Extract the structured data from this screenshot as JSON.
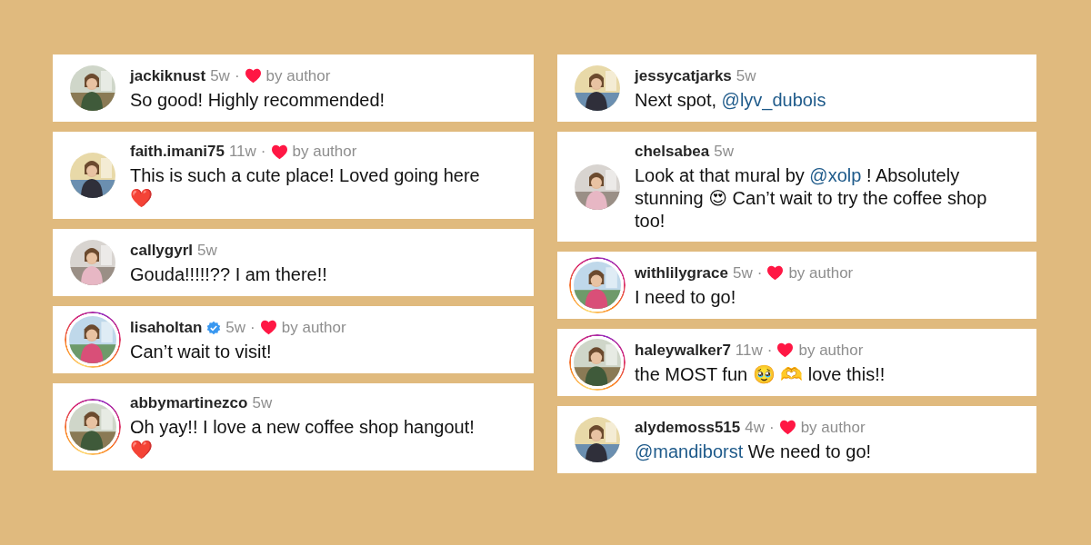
{
  "columns": [
    {
      "comments": [
        {
          "username": "jackiknust",
          "verified": false,
          "time": "5w",
          "separator": "·",
          "liked_by_author": true,
          "liked_label": "by author",
          "story_ring": false,
          "text": [
            {
              "kind": "text",
              "text": "So good! Highly recommended!"
            }
          ]
        },
        {
          "username": "faith.imani75",
          "verified": false,
          "time": "11w",
          "separator": "·",
          "liked_by_author": true,
          "liked_label": "by author",
          "story_ring": false,
          "text": [
            {
              "kind": "text",
              "text": "This is such a cute place! Loved going here ❤️"
            }
          ]
        },
        {
          "username": "callygyrl",
          "verified": false,
          "time": "5w",
          "liked_by_author": false,
          "story_ring": false,
          "text": [
            {
              "kind": "text",
              "text": "Gouda!!!!!?? I am there!!"
            }
          ]
        },
        {
          "username": "lisaholtan",
          "verified": true,
          "time": "5w",
          "separator": "·",
          "liked_by_author": true,
          "liked_label": "by author",
          "story_ring": true,
          "text": [
            {
              "kind": "text",
              "text": "Can’t wait to visit!"
            }
          ]
        },
        {
          "username": "abbymartinezco",
          "verified": false,
          "time": "5w",
          "liked_by_author": false,
          "story_ring": true,
          "text": [
            {
              "kind": "text",
              "text": "Oh yay!! I love a new coffee shop hangout! ❤️"
            }
          ]
        }
      ]
    },
    {
      "comments": [
        {
          "username": "jessycatjarks",
          "verified": false,
          "time": "5w",
          "liked_by_author": false,
          "story_ring": false,
          "text": [
            {
              "kind": "text",
              "text": "Next spot, "
            },
            {
              "kind": "mention",
              "text": "@lyv_dubois"
            }
          ]
        },
        {
          "username": "chelsabea",
          "verified": false,
          "time": "5w",
          "liked_by_author": false,
          "story_ring": false,
          "text": [
            {
              "kind": "text",
              "text": "Look at that mural by "
            },
            {
              "kind": "mention",
              "text": "@xolp"
            },
            {
              "kind": "text",
              "text": " ! Absolutely stunning 😍 Can’t wait to try the coffee shop too!"
            }
          ]
        },
        {
          "username": "withlilygrace",
          "verified": false,
          "time": "5w",
          "separator": "·",
          "liked_by_author": true,
          "liked_label": "by author",
          "story_ring": true,
          "text": [
            {
              "kind": "text",
              "text": "I need to go!"
            }
          ]
        },
        {
          "username": "haleywalker7",
          "verified": false,
          "time": "11w",
          "separator": "·",
          "liked_by_author": true,
          "liked_label": "by author",
          "story_ring": true,
          "text": [
            {
              "kind": "text",
              "text": "the MOST fun 🥹 🫶 love this!!"
            }
          ]
        },
        {
          "username": "alydemoss515",
          "verified": false,
          "time": "4w",
          "separator": "·",
          "liked_by_author": true,
          "liked_label": "by author",
          "story_ring": false,
          "text": [
            {
              "kind": "mention",
              "text": "@mandiborst"
            },
            {
              "kind": "text",
              "text": " We need to go!"
            }
          ]
        }
      ]
    }
  ]
}
